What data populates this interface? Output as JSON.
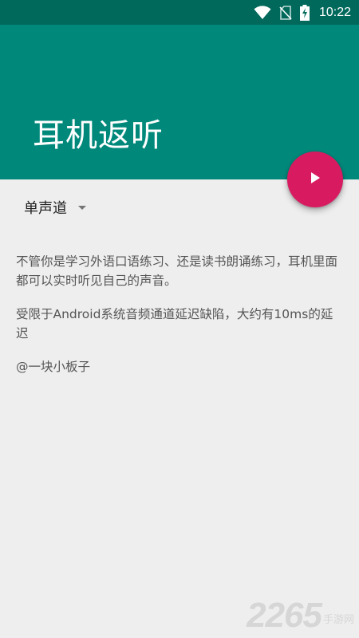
{
  "status_bar": {
    "time": "10:22",
    "icons": [
      "wifi-icon",
      "no-sim-icon",
      "battery-charging-icon"
    ]
  },
  "app_bar": {
    "title": "耳机返听"
  },
  "fab": {
    "icon": "play-icon",
    "color": "#d81b60"
  },
  "channel_spinner": {
    "selected": "单声道"
  },
  "description": {
    "paragraph1": "不管你是学习外语口语练习、还是读书朗诵练习，耳机里面都可以实时听见自己的声音。",
    "paragraph2": " 受限于Android系统音频通道延迟缺陷，大约有10ms的延迟",
    "paragraph3": " @一块小板子"
  },
  "watermark": {
    "number": "2265",
    "text": "手游网"
  },
  "colors": {
    "status_bar": "#00695c",
    "primary": "#00897b",
    "accent": "#d81b60",
    "background": "#eeeeee"
  }
}
